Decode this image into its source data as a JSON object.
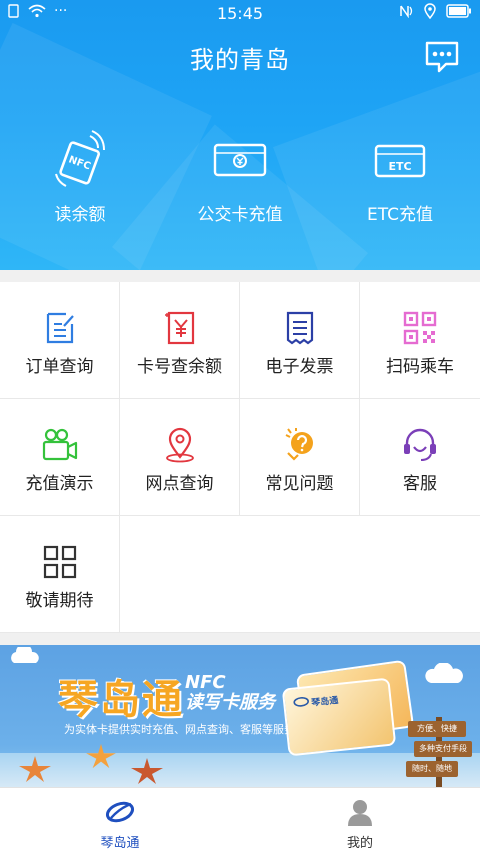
{
  "status_bar": {
    "time": "15:45",
    "dots": "···"
  },
  "header": {
    "title": "我的青岛",
    "actions": [
      {
        "label": "读余额",
        "icon": "nfc-card-icon",
        "icon_text": "NFC"
      },
      {
        "label": "公交卡充值",
        "icon": "bus-card-recharge-icon"
      },
      {
        "label": "ETC充值",
        "icon": "etc-card-icon",
        "icon_text": "ETC"
      }
    ]
  },
  "grid": {
    "items": [
      {
        "label": "订单查询",
        "icon": "order-icon",
        "color": "#2f7de1"
      },
      {
        "label": "卡号查余额",
        "icon": "card-balance-icon",
        "color": "#e2373f"
      },
      {
        "label": "电子发票",
        "icon": "invoice-icon",
        "color": "#2b3fa6"
      },
      {
        "label": "扫码乘车",
        "icon": "qr-code-icon",
        "color": "#e56bd1"
      },
      {
        "label": "充值演示",
        "icon": "video-camera-icon",
        "color": "#34c23b"
      },
      {
        "label": "网点查询",
        "icon": "location-icon",
        "color": "#e2373f"
      },
      {
        "label": "常见问题",
        "icon": "faq-bulb-icon",
        "color": "#f4a21c"
      },
      {
        "label": "客服",
        "icon": "headset-icon",
        "color": "#7b3fb8"
      },
      {
        "label": "敬请期待",
        "icon": "grid-icon",
        "color": "#333333"
      }
    ]
  },
  "banner": {
    "title": "琴岛通",
    "nfc_line1": "NFC",
    "nfc_line2": "读写卡服务",
    "subtitle": "为实体卡提供实时充值、网点查询、客服等服务",
    "card_name": "琴岛通",
    "signs": [
      "方便、快捷",
      "多种支付手段",
      "随时、随地"
    ]
  },
  "bottom_nav": {
    "items": [
      {
        "label": "琴岛通",
        "icon": "qindaotong-logo-icon",
        "active": true,
        "color": "#1f4fbf"
      },
      {
        "label": "我的",
        "icon": "user-icon",
        "active": false,
        "color": "#333333"
      }
    ]
  }
}
